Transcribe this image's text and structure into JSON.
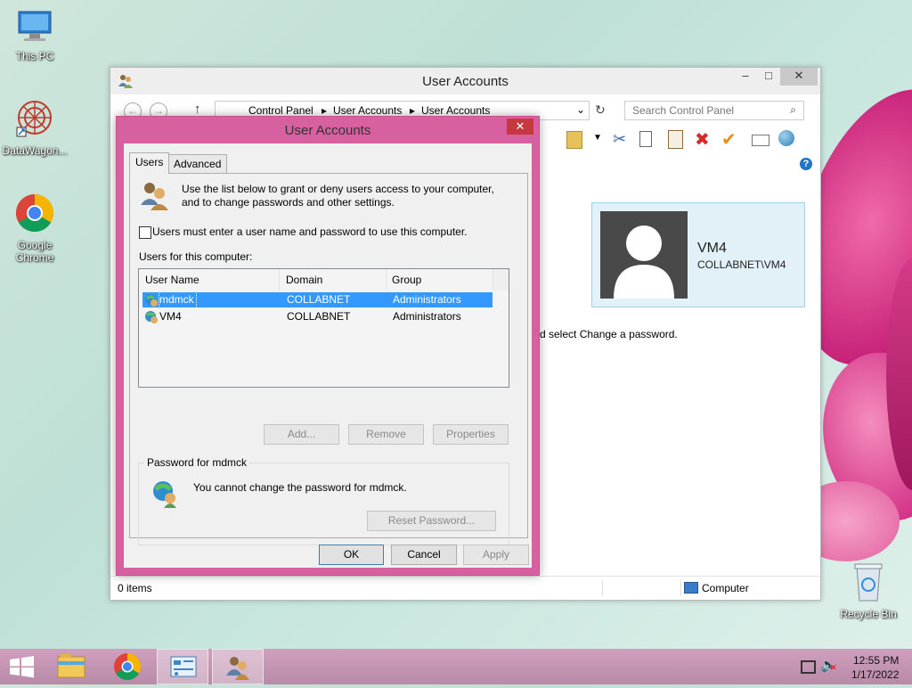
{
  "desktop": {
    "icons": [
      {
        "label": "This PC"
      },
      {
        "label": "DataWagon..."
      },
      {
        "label": "Google Chrome"
      },
      {
        "label": "Recycle Bin"
      }
    ]
  },
  "explorer": {
    "title": "User Accounts",
    "breadcrumb": [
      "Control Panel",
      "User Accounts",
      "User Accounts"
    ],
    "search_placeholder": "Search Control Panel",
    "user_name": "VM4",
    "user_domain": "COLLABNET\\VM4",
    "partial_text": "d select Change a password.",
    "status_items": "0 items",
    "status_location": "Computer"
  },
  "dialog": {
    "title": "User Accounts",
    "tabs": [
      "Users",
      "Advanced"
    ],
    "intro": "Use the list below to grant or deny users access to your computer, and to change passwords and other settings.",
    "checkbox_label": "Users must enter a user name and password to use this computer.",
    "checkbox_checked": false,
    "list_label": "Users for this computer:",
    "columns": [
      "User Name",
      "Domain",
      "Group"
    ],
    "rows": [
      {
        "name": "mdmck",
        "domain": "COLLABNET",
        "group": "Administrators",
        "selected": true
      },
      {
        "name": "VM4",
        "domain": "COLLABNET",
        "group": "Administrators",
        "selected": false
      }
    ],
    "add_button": "Add...",
    "remove_button": "Remove",
    "properties_button": "Properties",
    "password_group_title": "Password for mdmck",
    "password_message": "You cannot change the password for mdmck.",
    "reset_button": "Reset Password...",
    "ok_button": "OK",
    "cancel_button": "Cancel",
    "apply_button": "Apply"
  },
  "taskbar": {
    "time": "12:55 PM",
    "date": "1/17/2022"
  },
  "colors": {
    "dialog_frame": "#d660a0",
    "selection": "#3399ff",
    "close_button": "#c7383e",
    "taskbar": "#c490b0"
  }
}
